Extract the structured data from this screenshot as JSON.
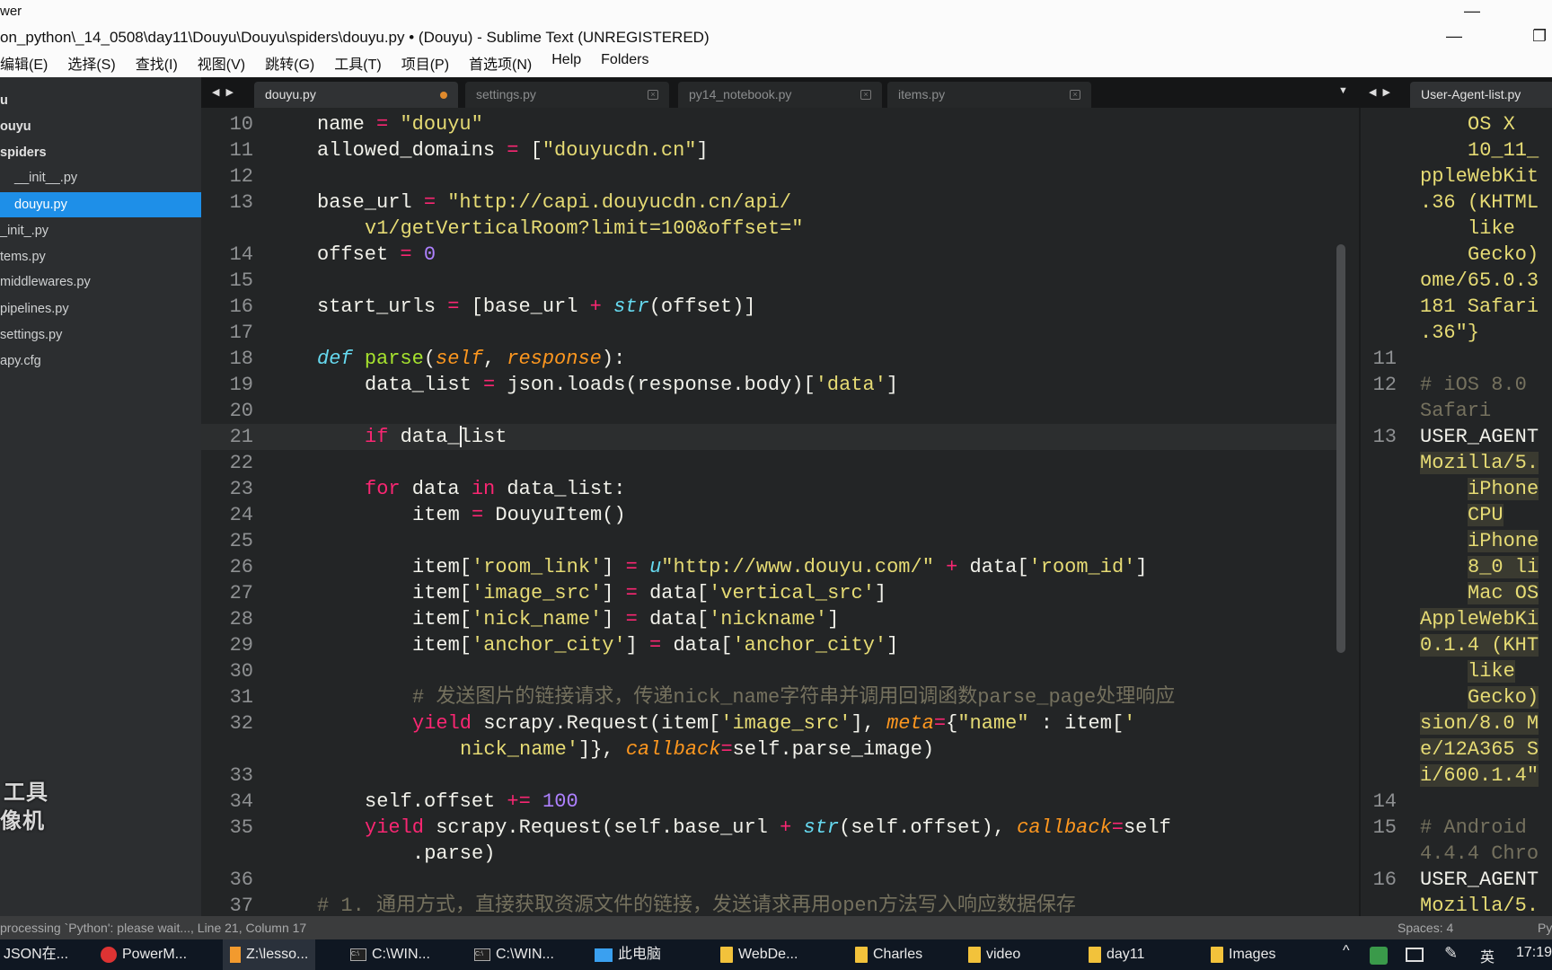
{
  "window": {
    "app_partial": "wer",
    "title": "on_python\\_14_0508\\day11\\Douyu\\Douyu\\spiders\\douyu.py • (Douyu) - Sublime Text (UNREGISTERED)",
    "controls": {
      "minimize": "—",
      "restore": "❐"
    }
  },
  "menu": [
    "编辑(E)",
    "选择(S)",
    "查找(I)",
    "视图(V)",
    "跳转(G)",
    "工具(T)",
    "项目(P)",
    "首选项(N)",
    "Help",
    "Folders"
  ],
  "sidebar": {
    "items": [
      {
        "label": "u",
        "style": "bold"
      },
      {
        "label": "ouyu",
        "style": "bold"
      },
      {
        "label": "spiders",
        "style": "bold"
      },
      {
        "label": "__init__.py",
        "style": "indent"
      },
      {
        "label": "douyu.py",
        "style": "selected"
      },
      {
        "label": "_init_.py",
        "style": ""
      },
      {
        "label": "tems.py",
        "style": ""
      },
      {
        "label": "middlewares.py",
        "style": ""
      },
      {
        "label": "pipelines.py",
        "style": ""
      },
      {
        "label": "settings.py",
        "style": ""
      },
      {
        "label": "apy.cfg",
        "style": ""
      }
    ],
    "watermark": [
      "工具",
      "像机"
    ]
  },
  "tabs": {
    "left": [
      {
        "label": "douyu.py",
        "active": true,
        "modified": true
      },
      {
        "label": "settings.py",
        "active": false
      },
      {
        "label": "py14_notebook.py",
        "active": false
      },
      {
        "label": "items.py",
        "active": false
      }
    ],
    "right": [
      {
        "label": "User-Agent-list.py",
        "active": true
      }
    ],
    "arrows": "◀ ▶",
    "dropdown": "▼"
  },
  "editor": {
    "current_line": "21",
    "rows": [
      {
        "n": "10",
        "i": 1,
        "t": [
          [
            "name",
            "p"
          ],
          [
            " = ",
            "op"
          ],
          [
            "\"douyu\"",
            "s"
          ]
        ]
      },
      {
        "n": "11",
        "i": 1,
        "t": [
          [
            "allowed_domains",
            "p"
          ],
          [
            " = ",
            "op"
          ],
          [
            "[",
            "p"
          ],
          [
            "\"douyucdn.cn\"",
            "s"
          ],
          [
            "]",
            "p"
          ]
        ]
      },
      {
        "n": "12",
        "i": 0,
        "t": []
      },
      {
        "n": "13",
        "i": 1,
        "t": [
          [
            "base_url",
            "p"
          ],
          [
            " = ",
            "op"
          ],
          [
            "\"http://capi.douyucdn.cn/api/",
            "s"
          ]
        ]
      },
      {
        "n": "",
        "i": 2,
        "t": [
          [
            "v1/getVerticalRoom?limit=100&offset=\"",
            "s"
          ]
        ]
      },
      {
        "n": "14",
        "i": 1,
        "t": [
          [
            "offset",
            "p"
          ],
          [
            " = ",
            "op"
          ],
          [
            "0",
            "n"
          ]
        ]
      },
      {
        "n": "15",
        "i": 0,
        "t": []
      },
      {
        "n": "16",
        "i": 1,
        "t": [
          [
            "start_urls",
            "p"
          ],
          [
            " = ",
            "op"
          ],
          [
            "[base_url",
            "p"
          ],
          [
            " + ",
            "op"
          ],
          [
            "str",
            "b"
          ],
          [
            "(offset)]",
            "p"
          ]
        ]
      },
      {
        "n": "17",
        "i": 0,
        "t": []
      },
      {
        "n": "18",
        "i": 1,
        "t": [
          [
            "def",
            "b"
          ],
          [
            " ",
            "p"
          ],
          [
            "parse",
            "f"
          ],
          [
            "(",
            "p"
          ],
          [
            "self",
            "a"
          ],
          [
            ", ",
            "p"
          ],
          [
            "response",
            "a"
          ],
          [
            "):",
            "p"
          ]
        ]
      },
      {
        "n": "19",
        "i": 2,
        "t": [
          [
            "data_list",
            "p"
          ],
          [
            " = ",
            "op"
          ],
          [
            "json.loads(response.body)[",
            "p"
          ],
          [
            "'data'",
            "s"
          ],
          [
            "]",
            "p"
          ]
        ]
      },
      {
        "n": "20",
        "i": 0,
        "t": []
      },
      {
        "n": "21",
        "i": 2,
        "t": [
          [
            "if",
            "k"
          ],
          [
            " data_",
            "p"
          ],
          [
            "|",
            "cursor"
          ],
          [
            "list",
            "p"
          ]
        ]
      },
      {
        "n": "22",
        "i": 0,
        "t": []
      },
      {
        "n": "23",
        "i": 2,
        "t": [
          [
            "for",
            "k"
          ],
          [
            " data ",
            "p"
          ],
          [
            "in",
            "k"
          ],
          [
            " data_list:",
            "p"
          ]
        ]
      },
      {
        "n": "24",
        "i": 3,
        "t": [
          [
            "item",
            "p"
          ],
          [
            " = ",
            "op"
          ],
          [
            "DouyuItem()",
            "p"
          ]
        ]
      },
      {
        "n": "25",
        "i": 0,
        "t": []
      },
      {
        "n": "26",
        "i": 3,
        "t": [
          [
            "item[",
            "p"
          ],
          [
            "'room_link'",
            "s"
          ],
          [
            "]",
            "p"
          ],
          [
            " = ",
            "op"
          ],
          [
            "u",
            "b"
          ],
          [
            "\"http://www.douyu.com/\"",
            "s"
          ],
          [
            " + ",
            "op"
          ],
          [
            "data[",
            "p"
          ],
          [
            "'room_id'",
            "s"
          ],
          [
            "]",
            "p"
          ]
        ]
      },
      {
        "n": "27",
        "i": 3,
        "t": [
          [
            "item[",
            "p"
          ],
          [
            "'image_src'",
            "s"
          ],
          [
            "]",
            "p"
          ],
          [
            " = ",
            "op"
          ],
          [
            "data[",
            "p"
          ],
          [
            "'vertical_src'",
            "s"
          ],
          [
            "]",
            "p"
          ]
        ]
      },
      {
        "n": "28",
        "i": 3,
        "t": [
          [
            "item[",
            "p"
          ],
          [
            "'nick_name'",
            "s"
          ],
          [
            "]",
            "p"
          ],
          [
            " = ",
            "op"
          ],
          [
            "data[",
            "p"
          ],
          [
            "'nickname'",
            "s"
          ],
          [
            "]",
            "p"
          ]
        ]
      },
      {
        "n": "29",
        "i": 3,
        "t": [
          [
            "item[",
            "p"
          ],
          [
            "'anchor_city'",
            "s"
          ],
          [
            "]",
            "p"
          ],
          [
            " = ",
            "op"
          ],
          [
            "data[",
            "p"
          ],
          [
            "'anchor_city'",
            "s"
          ],
          [
            "]",
            "p"
          ]
        ]
      },
      {
        "n": "30",
        "i": 0,
        "t": []
      },
      {
        "n": "31",
        "i": 3,
        "t": [
          [
            "# 发送图片的链接请求，传递nick_name字符串并调用回调函数parse_page处理响应",
            "c"
          ]
        ]
      },
      {
        "n": "32",
        "i": 3,
        "t": [
          [
            "yield",
            "k"
          ],
          [
            " scrapy.Request(item[",
            "p"
          ],
          [
            "'image_src'",
            "s"
          ],
          [
            "], ",
            "p"
          ],
          [
            "meta",
            "a"
          ],
          [
            "=",
            "op"
          ],
          [
            "{",
            "p"
          ],
          [
            "\"name\"",
            "s"
          ],
          [
            " : item[",
            "p"
          ],
          [
            "'",
            "s"
          ]
        ]
      },
      {
        "n": "",
        "i": 4,
        "t": [
          [
            "nick_name'",
            "s"
          ],
          [
            "]}, ",
            "p"
          ],
          [
            "callback",
            "a"
          ],
          [
            "=",
            "op"
          ],
          [
            "self.parse_image)",
            "p"
          ]
        ]
      },
      {
        "n": "33",
        "i": 0,
        "t": []
      },
      {
        "n": "34",
        "i": 2,
        "t": [
          [
            "self.offset",
            "p"
          ],
          [
            " += ",
            "op"
          ],
          [
            "100",
            "n"
          ]
        ]
      },
      {
        "n": "35",
        "i": 2,
        "t": [
          [
            "yield",
            "k"
          ],
          [
            " scrapy.Request(self.base_url",
            "p"
          ],
          [
            " + ",
            "op"
          ],
          [
            "str",
            "b"
          ],
          [
            "(self.offset), ",
            "p"
          ],
          [
            "callback",
            "a"
          ],
          [
            "=",
            "op"
          ],
          [
            "self",
            "p"
          ]
        ]
      },
      {
        "n": "",
        "i": 3,
        "t": [
          [
            ".parse)",
            "p"
          ]
        ]
      },
      {
        "n": "36",
        "i": 0,
        "t": []
      },
      {
        "n": "37",
        "i": 1,
        "t": [
          [
            "# 1. 通用方式，直接获取资源文件的链接，发送请求再用open方法写入响应数据保存",
            "c"
          ]
        ]
      }
    ]
  },
  "right_editor": {
    "rows": [
      {
        "n": "",
        "i": 1,
        "h": false,
        "t": [
          [
            "OS X",
            "s"
          ]
        ]
      },
      {
        "n": "",
        "i": 1,
        "h": false,
        "t": [
          [
            "10_11_",
            "s"
          ]
        ]
      },
      {
        "n": "",
        "i": 0,
        "h": false,
        "t": [
          [
            "ppleWebKit",
            "s"
          ]
        ]
      },
      {
        "n": "",
        "i": 0,
        "h": false,
        "t": [
          [
            ".36 (KHTML",
            "s"
          ]
        ]
      },
      {
        "n": "",
        "i": 1,
        "h": false,
        "t": [
          [
            "like",
            "s"
          ]
        ]
      },
      {
        "n": "",
        "i": 1,
        "h": false,
        "t": [
          [
            "Gecko)",
            "s"
          ]
        ]
      },
      {
        "n": "",
        "i": 0,
        "h": false,
        "t": [
          [
            "ome/65.0.3",
            "s"
          ]
        ]
      },
      {
        "n": "",
        "i": 0,
        "h": false,
        "t": [
          [
            "181 Safari",
            "s"
          ]
        ]
      },
      {
        "n": "",
        "i": 0,
        "h": false,
        "t": [
          [
            ".36\"}",
            "s"
          ]
        ]
      },
      {
        "n": "11",
        "i": 0,
        "h": false,
        "t": []
      },
      {
        "n": "12",
        "i": 0,
        "h": false,
        "t": [
          [
            "# iOS 8.0",
            "c"
          ]
        ]
      },
      {
        "n": "",
        "i": 0,
        "h": false,
        "t": [
          [
            "Safari",
            "c"
          ]
        ]
      },
      {
        "n": "13",
        "i": 0,
        "h": false,
        "t": [
          [
            "USER_AGENT",
            "p"
          ]
        ]
      },
      {
        "n": "",
        "i": 0,
        "h": true,
        "t": [
          [
            "Mozilla/5.",
            "s"
          ]
        ]
      },
      {
        "n": "",
        "i": 1,
        "h": true,
        "t": [
          [
            "iPhone",
            "s"
          ]
        ]
      },
      {
        "n": "",
        "i": 1,
        "h": true,
        "t": [
          [
            "CPU",
            "s"
          ]
        ]
      },
      {
        "n": "",
        "i": 1,
        "h": true,
        "t": [
          [
            "iPhone",
            "s"
          ]
        ]
      },
      {
        "n": "",
        "i": 1,
        "h": true,
        "t": [
          [
            "8_0 li",
            "s"
          ]
        ]
      },
      {
        "n": "",
        "i": 1,
        "h": true,
        "t": [
          [
            "Mac OS",
            "s"
          ]
        ]
      },
      {
        "n": "",
        "i": 0,
        "h": true,
        "t": [
          [
            "AppleWebKi",
            "s"
          ]
        ]
      },
      {
        "n": "",
        "i": 0,
        "h": true,
        "t": [
          [
            "0.1.4 (KHT",
            "s"
          ]
        ]
      },
      {
        "n": "",
        "i": 1,
        "h": true,
        "t": [
          [
            "like",
            "s"
          ]
        ]
      },
      {
        "n": "",
        "i": 1,
        "h": true,
        "t": [
          [
            "Gecko)",
            "s"
          ]
        ]
      },
      {
        "n": "",
        "i": 0,
        "h": true,
        "t": [
          [
            "sion/8.0 M",
            "s"
          ]
        ]
      },
      {
        "n": "",
        "i": 0,
        "h": true,
        "t": [
          [
            "e/12A365 S",
            "s"
          ]
        ]
      },
      {
        "n": "",
        "i": 0,
        "h": true,
        "t": [
          [
            "i/600.1.4\"",
            "s"
          ]
        ]
      },
      {
        "n": "14",
        "i": 0,
        "h": false,
        "t": []
      },
      {
        "n": "15",
        "i": 0,
        "h": false,
        "t": [
          [
            "# Android",
            "c"
          ]
        ]
      },
      {
        "n": "",
        "i": 0,
        "h": false,
        "t": [
          [
            "4.4.4 Chro",
            "c"
          ]
        ]
      },
      {
        "n": "16",
        "i": 0,
        "h": false,
        "t": [
          [
            "USER_AGENT",
            "p"
          ]
        ]
      },
      {
        "n": "",
        "i": 0,
        "h": false,
        "t": [
          [
            "Mozilla/5.",
            "s"
          ]
        ]
      }
    ]
  },
  "status": {
    "message": "processing `Python': please wait..., Line 21, Column 17",
    "spaces": "Spaces: 4",
    "syntax": "Py"
  },
  "taskbar": {
    "items": [
      {
        "label": "JSON在...",
        "icon": "none"
      },
      {
        "label": "PowerM...",
        "icon": "powermockup-icon"
      },
      {
        "label": "Z:\\lesso...",
        "icon": "sublime-icon",
        "active": true
      },
      {
        "label": "C:\\WIN...",
        "icon": "cmd-icon"
      },
      {
        "label": "C:\\WIN...",
        "icon": "cmd-icon"
      },
      {
        "label": "此电脑",
        "icon": "computer-icon"
      },
      {
        "label": "WebDe...",
        "icon": "folder-icon"
      },
      {
        "label": "Charles",
        "icon": "folder-icon"
      },
      {
        "label": "video",
        "icon": "folder-icon"
      },
      {
        "label": "day11",
        "icon": "folder-icon"
      },
      {
        "label": "Images",
        "icon": "folder-icon"
      }
    ],
    "tray": {
      "chevron": "^",
      "ime": "英",
      "time": "17:19"
    }
  }
}
